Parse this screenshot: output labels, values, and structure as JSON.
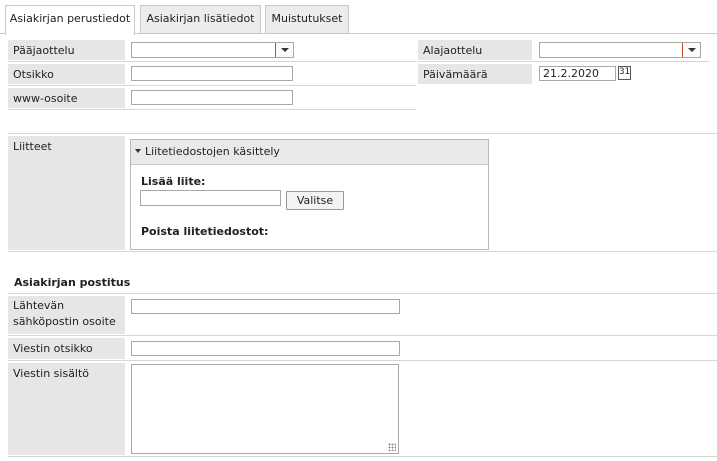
{
  "tabs": [
    {
      "label": "Asiakirjan perustiedot",
      "active": true
    },
    {
      "label": "Asiakirjan lisätiedot",
      "active": false
    },
    {
      "label": "Muistutukset",
      "active": false
    }
  ],
  "fields": {
    "paajaottelu": {
      "label": "Pääjaottelu",
      "value": ""
    },
    "otsikko": {
      "label": "Otsikko",
      "value": ""
    },
    "www": {
      "label": "www-osoite",
      "value": ""
    },
    "alajaottelu": {
      "label": "Alajaottelu",
      "value": ""
    },
    "paivamaara": {
      "label": "Päivämäärä",
      "value": "21.2.2020"
    },
    "calendar_icon_text": "31"
  },
  "attachments": {
    "label": "Liitteet",
    "panel_title": "Liitetiedostojen käsittely",
    "add_label": "Lisää liite:",
    "file_value": "",
    "choose_button": "Valitse",
    "remove_label": "Poista liitetiedostot:"
  },
  "mailing": {
    "section_title": "Asiakirjan postitus",
    "sender_label_line1": "Lähtevän",
    "sender_label_line2": "sähköpostin osoite",
    "sender_value": "",
    "subject_label": "Viestin otsikko",
    "subject_value": "",
    "body_label": "Viestin sisältö",
    "body_value": ""
  }
}
